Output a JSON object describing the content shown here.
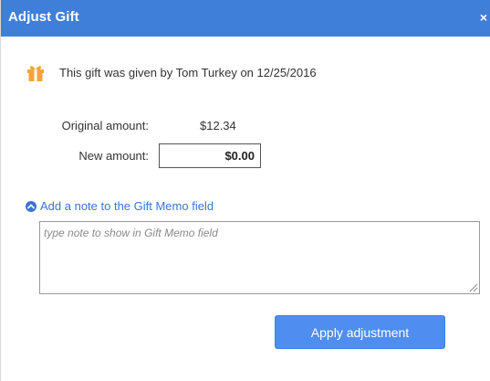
{
  "dialog": {
    "title": "Adjust Gift",
    "close_glyph": "×",
    "title_bar_color": "#3f7fd9"
  },
  "gift_info": {
    "icon": "gift-icon",
    "icon_color": "#f0a53c",
    "text": "This gift was given by Tom Turkey on 12/25/2016"
  },
  "amounts": {
    "original_label": "Original amount:",
    "original_value": "$12.34",
    "new_label": "New amount:",
    "new_value": "$0.00"
  },
  "memo": {
    "toggle_icon": "chevron-up-circle-icon",
    "toggle_label": "Add a note to the Gift Memo field",
    "placeholder": "type note to show in Gift Memo field",
    "value": ""
  },
  "actions": {
    "apply_label": "Apply adjustment",
    "apply_color": "#4f8df0"
  }
}
